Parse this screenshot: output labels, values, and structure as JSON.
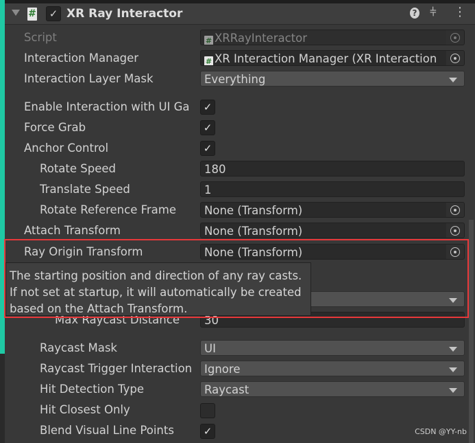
{
  "component": {
    "title": "XR Ray Interactor",
    "enabled": true,
    "icon": "csharp-script-icon"
  },
  "header_icons": [
    "help-icon",
    "preset-icon",
    "more-vertical-icon"
  ],
  "rows": {
    "script": {
      "label": "Script",
      "value": "XRRayInteractor"
    },
    "interaction_manager": {
      "label": "Interaction Manager",
      "value": "XR Interaction Manager (XR Interaction"
    },
    "interaction_layer_mask": {
      "label": "Interaction Layer Mask",
      "value": "Everything"
    },
    "enable_ui": {
      "label": "Enable Interaction with UI Ga",
      "checked": true
    },
    "force_grab": {
      "label": "Force Grab",
      "checked": true
    },
    "anchor_control": {
      "label": "Anchor Control",
      "checked": true
    },
    "rotate_speed": {
      "label": "Rotate Speed",
      "value": "180"
    },
    "translate_speed": {
      "label": "Translate Speed",
      "value": "1"
    },
    "rotate_reference_frame": {
      "label": "Rotate Reference Frame",
      "value": "None (Transform)"
    },
    "attach_transform": {
      "label": "Attach Transform",
      "value": "None (Transform)"
    },
    "ray_origin_transform": {
      "label": "Ray Origin Transform",
      "value": "None (Transform)"
    },
    "max_raycast_distance": {
      "label": "Max Raycast Distance",
      "value": "30"
    },
    "raycast_mask": {
      "label": "Raycast Mask",
      "value": "UI"
    },
    "raycast_trigger": {
      "label": "Raycast Trigger Interaction",
      "value": "Ignore"
    },
    "hit_detection": {
      "label": "Hit Detection Type",
      "value": "Raycast"
    },
    "hit_closest": {
      "label": "Hit Closest Only",
      "checked": false
    },
    "blend_points": {
      "label": "Blend Visual Line Points",
      "checked": true
    }
  },
  "tooltip": "The starting position and direction of any ray casts. If not set at startup, it will automatically be created based on the Attach Transform.",
  "highlight_color": "#e8383a",
  "watermark": "CSDN @YY-nb"
}
